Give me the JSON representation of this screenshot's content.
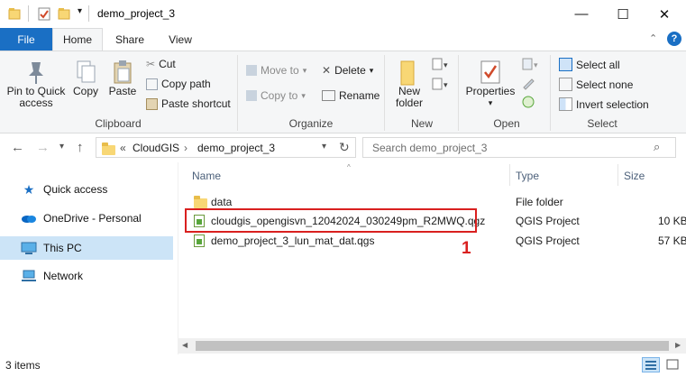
{
  "window": {
    "title": "demo_project_3",
    "minimize_glyph": "—",
    "maximize_glyph": "☐",
    "close_glyph": "✕"
  },
  "ribbon_tabs": {
    "file": "File",
    "home": "Home",
    "share": "Share",
    "view": "View"
  },
  "ribbon": {
    "clipboard": {
      "pin_label_1": "Pin to Quick",
      "pin_label_2": "access",
      "copy": "Copy",
      "paste": "Paste",
      "cut": "Cut",
      "copy_path": "Copy path",
      "paste_shortcut": "Paste shortcut",
      "group": "Clipboard"
    },
    "organize": {
      "move_to": "Move to",
      "copy_to": "Copy to",
      "delete": "Delete",
      "rename": "Rename",
      "group": "Organize"
    },
    "new": {
      "new_folder_1": "New",
      "new_folder_2": "folder",
      "group": "New"
    },
    "open": {
      "properties": "Properties",
      "group": "Open"
    },
    "select": {
      "select_all": "Select all",
      "select_none": "Select none",
      "invert_selection": "Invert selection",
      "group": "Select"
    }
  },
  "address": {
    "overflow": "«",
    "crumbs": [
      "CloudGIS",
      "demo_project_3"
    ],
    "search_placeholder": "Search demo_project_3"
  },
  "nav_pane": {
    "items": [
      "Quick access",
      "OneDrive - Personal",
      "This PC",
      "Network"
    ],
    "selected": "This PC"
  },
  "columns": {
    "name": "Name",
    "type": "Type",
    "size": "Size"
  },
  "files": [
    {
      "name": "data",
      "type": "File folder",
      "size": "",
      "icon": "folder-icon"
    },
    {
      "name": "cloudgis_opengisvn_12042024_030249pm_R2MWQ.qgz",
      "type": "QGIS Project",
      "size": "10 KB",
      "icon": "qgis-file-icon"
    },
    {
      "name": "demo_project_3_lun_mat_dat.qgs",
      "type": "QGIS Project",
      "size": "57 KB",
      "icon": "qgis-file-icon"
    }
  ],
  "annotation": {
    "label": "1",
    "color": "#d9201f"
  },
  "status": {
    "items_count": "3 items"
  },
  "colors": {
    "accent": "#1a6fc4",
    "selected_nav": "#cce4f7",
    "highlight_box": "#d9201f"
  }
}
